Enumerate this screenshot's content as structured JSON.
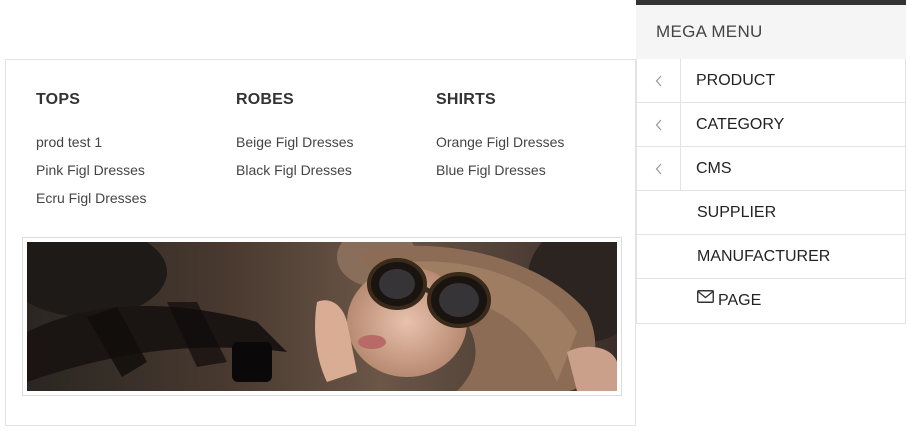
{
  "menu": {
    "title": "MEGA MENU",
    "items": [
      {
        "label": "PRODUCT",
        "icon": "chevron-left-icon"
      },
      {
        "label": "CATEGORY",
        "icon": "chevron-left-icon"
      },
      {
        "label": "CMS",
        "icon": "chevron-left-icon"
      },
      {
        "label": "SUPPLIER"
      },
      {
        "label": "MANUFACTURER"
      },
      {
        "label": "PAGE",
        "icon": "envelope-icon"
      }
    ]
  },
  "dropdown": {
    "columns": [
      {
        "title": "TOPS",
        "links": [
          "prod test 1",
          "Pink Figl Dresses",
          "Ecru Figl Dresses"
        ]
      },
      {
        "title": "ROBES",
        "links": [
          "Beige Figl Dresses",
          "Black Figl Dresses"
        ]
      },
      {
        "title": "SHIRTS",
        "links": [
          "Orange Figl Dresses",
          "Blue Figl Dresses"
        ]
      }
    ],
    "banner": {
      "alt": "fashion-banner-image"
    }
  },
  "colors": {
    "header_bar": "#333333",
    "header_bg": "#f5f5f5",
    "border": "#e3e3e3",
    "text": "#333333"
  }
}
